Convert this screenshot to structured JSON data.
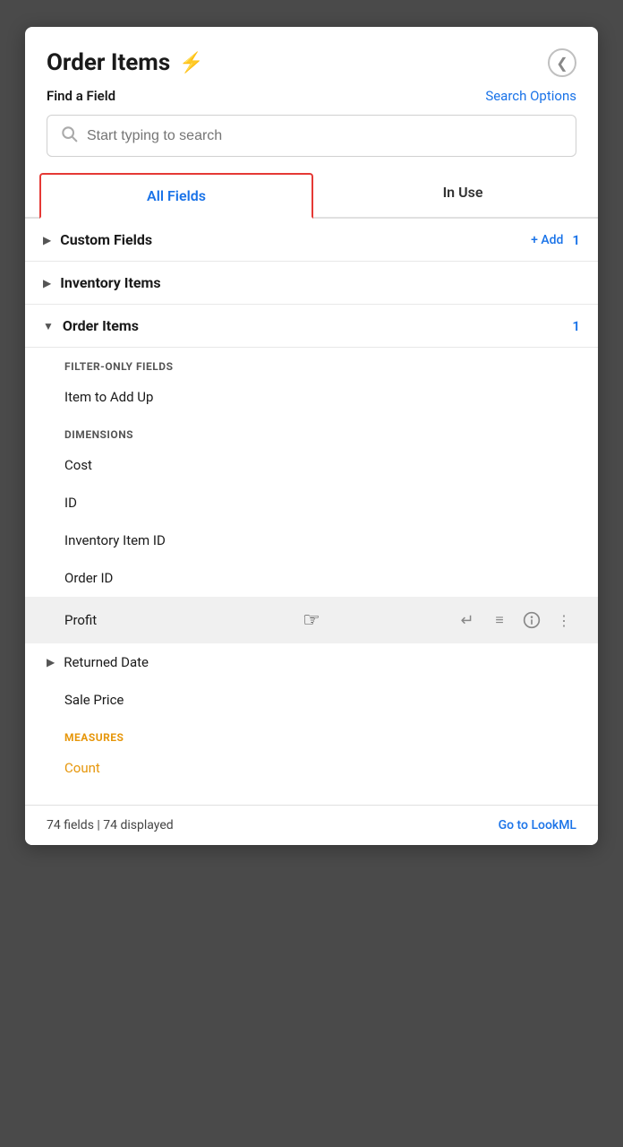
{
  "panel": {
    "title": "Order Items",
    "back_icon": "‹",
    "lightning_icon": "⚡"
  },
  "toolbar": {
    "find_field_label": "Find a Field",
    "search_options_label": "Search Options"
  },
  "search": {
    "placeholder": "Start typing to search"
  },
  "tabs": {
    "all_fields": "All Fields",
    "in_use": "In Use"
  },
  "groups": [
    {
      "id": "custom-fields",
      "name": "Custom Fields",
      "expanded": false,
      "show_add": true,
      "add_label": "+ Add",
      "count": "1"
    },
    {
      "id": "inventory-items",
      "name": "Inventory Items",
      "expanded": false,
      "show_add": false,
      "count": null
    },
    {
      "id": "order-items",
      "name": "Order Items",
      "expanded": true,
      "show_add": false,
      "count": "1"
    }
  ],
  "order_items_sections": [
    {
      "type": "section-header",
      "label": "FILTER-ONLY FIELDS",
      "style": "normal"
    },
    {
      "type": "field",
      "name": "Item to Add Up",
      "highlighted": false
    },
    {
      "type": "section-header",
      "label": "DIMENSIONS",
      "style": "normal"
    },
    {
      "type": "field",
      "name": "Cost",
      "highlighted": false
    },
    {
      "type": "field",
      "name": "ID",
      "highlighted": false
    },
    {
      "type": "field",
      "name": "Inventory Item ID",
      "highlighted": false
    },
    {
      "type": "field",
      "name": "Order ID",
      "highlighted": false
    },
    {
      "type": "field",
      "name": "Profit",
      "highlighted": true,
      "show_actions": true
    },
    {
      "type": "field-expand",
      "name": "Returned Date",
      "has_expand": true
    },
    {
      "type": "field",
      "name": "Sale Price",
      "highlighted": false
    },
    {
      "type": "section-header",
      "label": "MEASURES",
      "style": "measures"
    },
    {
      "type": "field",
      "name": "Count",
      "highlighted": false,
      "style": "measures"
    }
  ],
  "footer": {
    "fields_count": "74 fields | 74 displayed",
    "goto_lookml": "Go to LookML"
  },
  "icons": {
    "search": "🔍",
    "lightning": "⚡",
    "back": "❮",
    "chevron_right": "▶",
    "chevron_down": "▼",
    "enter_return": "↵",
    "filter_lines": "≡",
    "info_circle": "ⓘ",
    "more_vertical": "⋮",
    "cursor_hand": "👆"
  },
  "colors": {
    "blue": "#1a73e8",
    "red": "#e53935",
    "orange": "#e6960a",
    "text_primary": "#1a1a1a",
    "text_secondary": "#555",
    "border": "#e0e0e0"
  }
}
